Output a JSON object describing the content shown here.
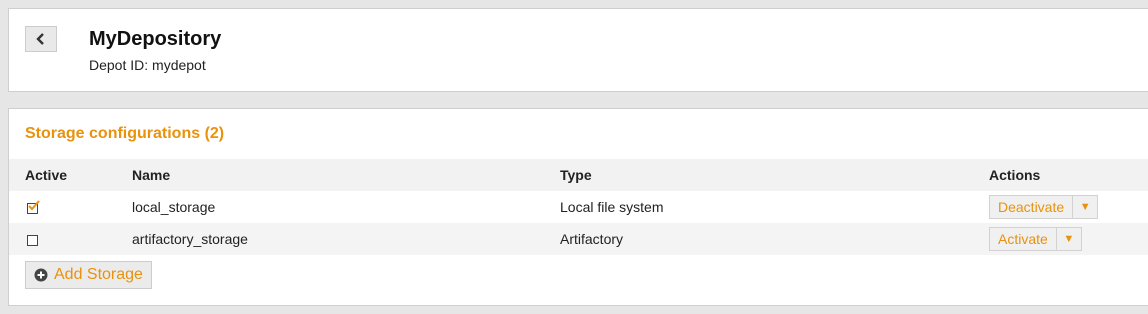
{
  "header": {
    "title": "MyDepository",
    "depot_id": "Depot ID: mydepot",
    "back_icon": "chevron-left-icon"
  },
  "storage": {
    "section_title": "Storage configurations (2)",
    "columns": {
      "active": "Active",
      "name": "Name",
      "type": "Type",
      "actions": "Actions"
    },
    "rows": [
      {
        "active": true,
        "name": "local_storage",
        "type": "Local file system",
        "action_label": "Deactivate",
        "dropdown": "▼"
      },
      {
        "active": false,
        "name": "artifactory_storage",
        "type": "Artifactory",
        "action_label": "Activate",
        "dropdown": "▼"
      }
    ],
    "add_label": "Add Storage",
    "add_icon": "plus-circle-icon"
  },
  "colors": {
    "accent": "#e8920e",
    "background": "#e6e6e6"
  }
}
